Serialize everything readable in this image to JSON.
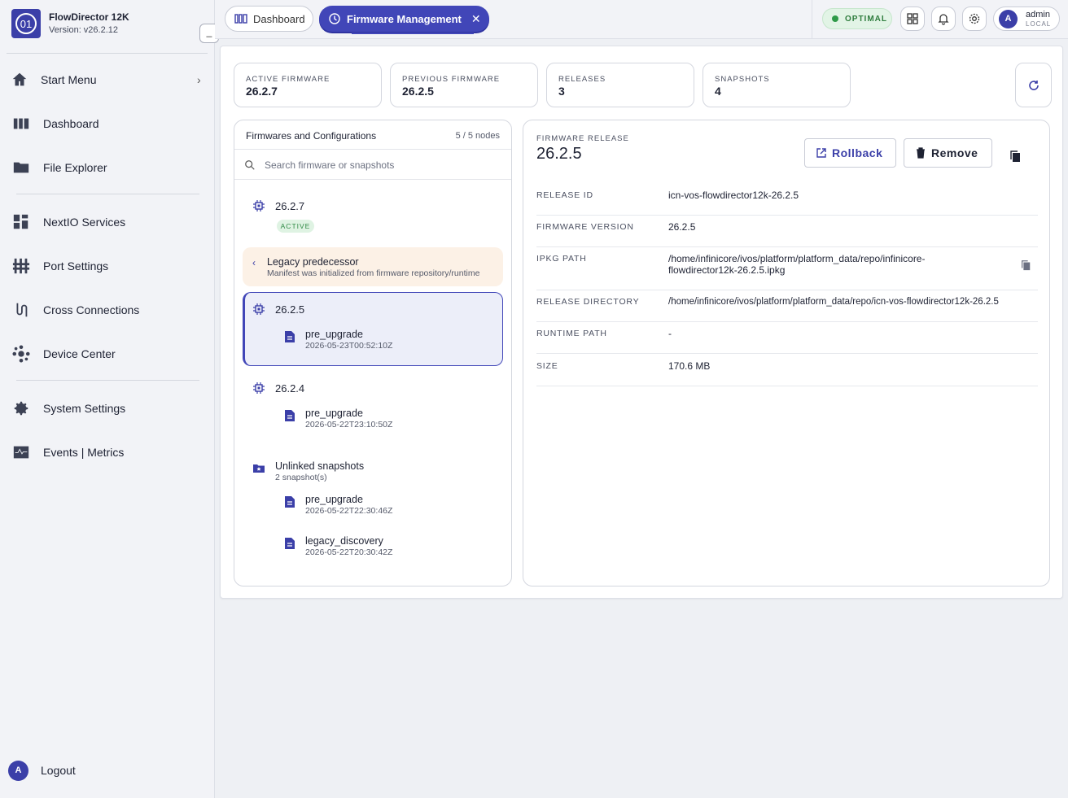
{
  "app": {
    "name": "FlowDirector 12K",
    "version": "Version: v26.2.12",
    "collapse": "_"
  },
  "sidebar": {
    "items": [
      {
        "label": "Start Menu",
        "icon": "home-icon",
        "chevron": "›"
      },
      {
        "label": "Dashboard",
        "icon": "dashboard-icon"
      },
      {
        "label": "File Explorer",
        "icon": "folder-icon"
      },
      {
        "label": "NextIO Services",
        "icon": "services-icon"
      },
      {
        "label": "Port Settings",
        "icon": "ports-icon"
      },
      {
        "label": "Cross Connections",
        "icon": "cross-connections-icon"
      },
      {
        "label": "Device Center",
        "icon": "device-center-icon"
      },
      {
        "label": "System Settings",
        "icon": "gear-icon"
      },
      {
        "label": "Events | Metrics",
        "icon": "metrics-icon"
      }
    ],
    "logout": {
      "avatar": "A",
      "label": "Logout"
    }
  },
  "topbar": {
    "tabs": [
      {
        "label": "Dashboard",
        "active": false
      },
      {
        "label": "Firmware Management",
        "active": true,
        "close": "✕"
      }
    ],
    "status": "OPTIMAL",
    "user": {
      "avatar": "A",
      "name": "admin",
      "scope": "LOCAL"
    }
  },
  "stats": [
    {
      "label": "ACTIVE FIRMWARE",
      "value": "26.2.7"
    },
    {
      "label": "PREVIOUS FIRMWARE",
      "value": "26.2.5"
    },
    {
      "label": "RELEASES",
      "value": "3"
    },
    {
      "label": "SNAPSHOTS",
      "value": "4"
    }
  ],
  "tree": {
    "title": "Firmwares and Configurations",
    "count": "5 / 5 nodes",
    "search_placeholder": "Search firmware or snapshots",
    "fw1": {
      "version": "26.2.7",
      "badge": "ACTIVE"
    },
    "legacy": {
      "title": "Legacy predecessor",
      "subtitle": "Manifest was initialized from firmware repository/runtime"
    },
    "fw2": {
      "version": "26.2.5",
      "snap_name": "pre_upgrade",
      "snap_time": "2026-05-23T00:52:10Z"
    },
    "fw3": {
      "version": "26.2.4",
      "snap_name": "pre_upgrade",
      "snap_time": "2026-05-22T23:10:50Z"
    },
    "unlinked": {
      "title": "Unlinked snapshots",
      "subtitle": "2 snapshot(s)",
      "s1_name": "pre_upgrade",
      "s1_time": "2026-05-22T22:30:46Z",
      "s2_name": "legacy_discovery",
      "s2_time": "2026-05-22T20:30:42Z"
    }
  },
  "detail": {
    "label": "FIRMWARE RELEASE",
    "version": "26.2.5",
    "rollback": "Rollback",
    "remove": "Remove",
    "rows": [
      {
        "key": "RELEASE ID",
        "value": "icn-vos-flowdirector12k-26.2.5"
      },
      {
        "key": "FIRMWARE VERSION",
        "value": "26.2.5"
      },
      {
        "key": "IPKG PATH",
        "value": "/home/infinicore/ivos/platform/platform_data/repo/infinicore-flowdirector12k-26.2.5.ipkg"
      },
      {
        "key": "RELEASE DIRECTORY",
        "value": "/home/infinicore/ivos/platform/platform_data/repo/icn-vos-flowdirector12k-26.2.5"
      },
      {
        "key": "RUNTIME PATH",
        "value": "-"
      },
      {
        "key": "SIZE",
        "value": "170.6 MB"
      }
    ]
  },
  "colors": {
    "accent": "#4146b8",
    "status_ok": "#2f9a49",
    "legacy_bg": "#fcf1e6"
  }
}
